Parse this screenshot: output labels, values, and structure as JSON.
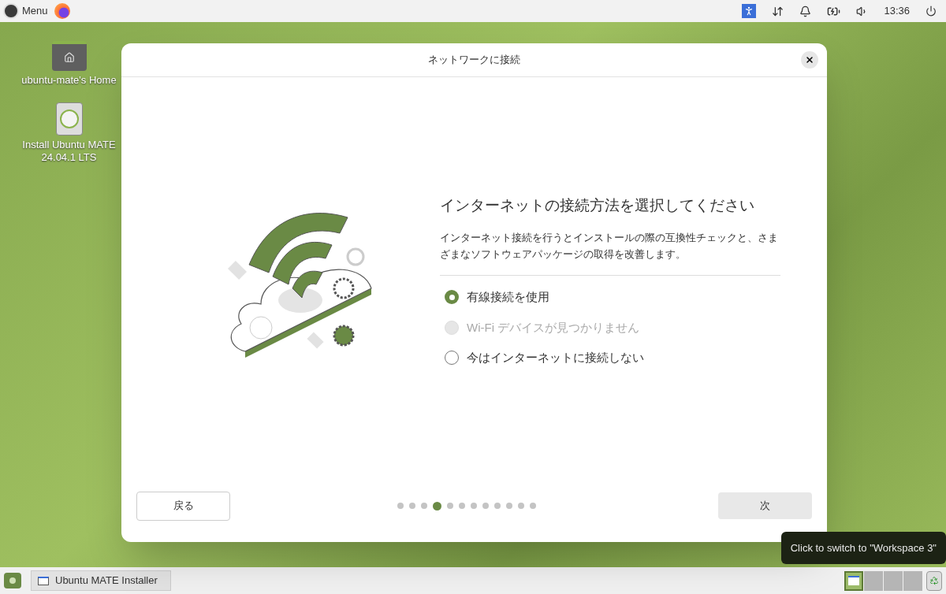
{
  "top_panel": {
    "menu_label": "Menu",
    "clock": "13:36"
  },
  "desktop_icons": [
    {
      "kind": "folder",
      "label": "ubuntu-mate's Home"
    },
    {
      "kind": "installer",
      "label": "Install Ubuntu MATE 24.04.1 LTS"
    }
  ],
  "dialog": {
    "title": "ネットワークに接続",
    "heading": "インターネットの接続方法を選択してください",
    "description": "インターネット接続を行うとインストールの際の互換性チェックと、さまざまなソフトウェアパッケージの取得を改善します。",
    "options": [
      {
        "label": "有線接続を使用",
        "selected": true,
        "disabled": false
      },
      {
        "label": "Wi-Fi デバイスが見つかりません",
        "selected": false,
        "disabled": true
      },
      {
        "label": "今はインターネットに接続しない",
        "selected": false,
        "disabled": false
      }
    ],
    "back_button": "戻る",
    "next_button": "次",
    "steps": [
      {
        "selected": false
      },
      {
        "selected": false
      },
      {
        "selected": false
      },
      {
        "selected": true
      },
      {
        "selected": false
      },
      {
        "selected": false
      },
      {
        "selected": false
      },
      {
        "selected": false
      },
      {
        "selected": false
      },
      {
        "selected": false
      },
      {
        "selected": false
      },
      {
        "selected": false
      }
    ]
  },
  "tooltip": "Click to switch to \"Workspace 3\"",
  "bottom_panel": {
    "task": "Ubuntu MATE Installer",
    "workspaces": [
      {
        "selected": true
      },
      {
        "selected": false
      },
      {
        "selected": false
      },
      {
        "selected": false
      }
    ]
  }
}
